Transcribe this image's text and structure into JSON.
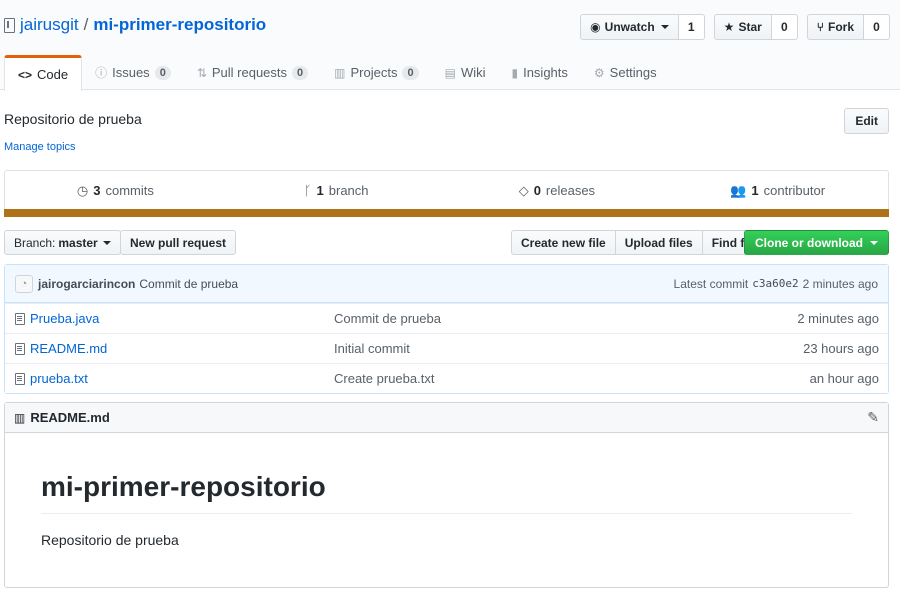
{
  "repo": {
    "owner": "jairusgit",
    "separator": "/",
    "name": "mi-primer-repositorio"
  },
  "actions": {
    "watch": {
      "label": "Unwatch",
      "count": "1",
      "icon": "eye-icon"
    },
    "star": {
      "label": "Star",
      "count": "0",
      "icon": "star-icon"
    },
    "fork": {
      "label": "Fork",
      "count": "0",
      "icon": "fork-icon"
    }
  },
  "nav": {
    "code": "Code",
    "issues": "Issues",
    "issues_count": "0",
    "pulls": "Pull requests",
    "pulls_count": "0",
    "projects": "Projects",
    "projects_count": "0",
    "wiki": "Wiki",
    "insights": "Insights",
    "settings": "Settings"
  },
  "description": "Repositorio de prueba",
  "manage_topics": "Manage topics",
  "edit_label": "Edit",
  "summary": {
    "commits_num": "3",
    "commits_label": "commits",
    "branch_num": "1",
    "branch_label": "branch",
    "releases_num": "0",
    "releases_label": "releases",
    "contributor_num": "1",
    "contributor_label": "contributor",
    "language_color": "#b07219"
  },
  "toolbar": {
    "branch_prefix": "Branch:",
    "branch_name": "master",
    "new_pr": "New pull request",
    "create_file": "Create new file",
    "upload_files": "Upload files",
    "find_file": "Find file",
    "clone": "Clone or download"
  },
  "commit": {
    "author": "jairogarciarincon",
    "message": "Commit de prueba",
    "latest_label": "Latest commit",
    "sha": "c3a60e2",
    "age": "2 minutes ago"
  },
  "files": [
    {
      "name": "Prueba.java",
      "message": "Commit de prueba",
      "age": "2 minutes ago"
    },
    {
      "name": "README.md",
      "message": "Initial commit",
      "age": "23 hours ago"
    },
    {
      "name": "prueba.txt",
      "message": "Create prueba.txt",
      "age": "an hour ago"
    }
  ],
  "readme": {
    "filename": "README.md",
    "heading": "mi-primer-repositorio",
    "body": "Repositorio de prueba"
  }
}
